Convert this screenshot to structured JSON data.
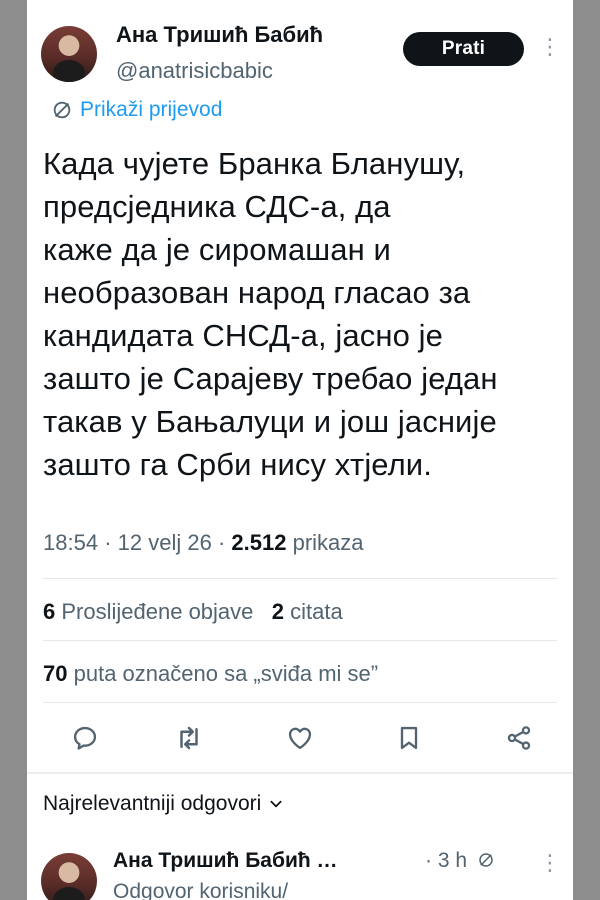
{
  "post": {
    "author_name": "Ана Тришић Бабић",
    "author_handle": "@anatrisicbabic",
    "follow_label": "Prati",
    "more_icon": "more-vertical-icon",
    "translate_label": "Prikaži prijevod",
    "text": "Када чујете Бранка Бланушу,\nпредсједника СДС-а, да\nкаже да је сиромашан и\nнеобразован народ гласао за\nкандидата СНСД-а, јасно је\nзашто је Сарајеву требао један\nтакав у Бањалуци и још јасније\nзашто га Срби нису хтјели.",
    "time": "18:54",
    "date": "12 velj 26",
    "views_count": "2.512",
    "views_label": "prikaza",
    "separator": "·"
  },
  "stats": {
    "reposts_count": "6",
    "reposts_label": "Proslijeđene objave",
    "quotes_count": "2",
    "quotes_label": "citata",
    "likes_count": "70",
    "likes_label": "puta označeno sa „sviđa mi se”"
  },
  "actions": [
    "reply-icon",
    "repost-icon",
    "like-icon",
    "bookmark-icon",
    "share-icon"
  ],
  "replies": {
    "title": "Najrelevantniji odgovori",
    "first_reply": {
      "author_name": "Ана Тришић Бабић …",
      "time": "· 3 h",
      "subtitle": "Odgovor korisniku/"
    }
  },
  "colors": {
    "accent": "#1d9bf0",
    "text": "#0f1419",
    "secondary": "#536471",
    "background": "#ffffff",
    "frame": "#8d8d8d"
  }
}
